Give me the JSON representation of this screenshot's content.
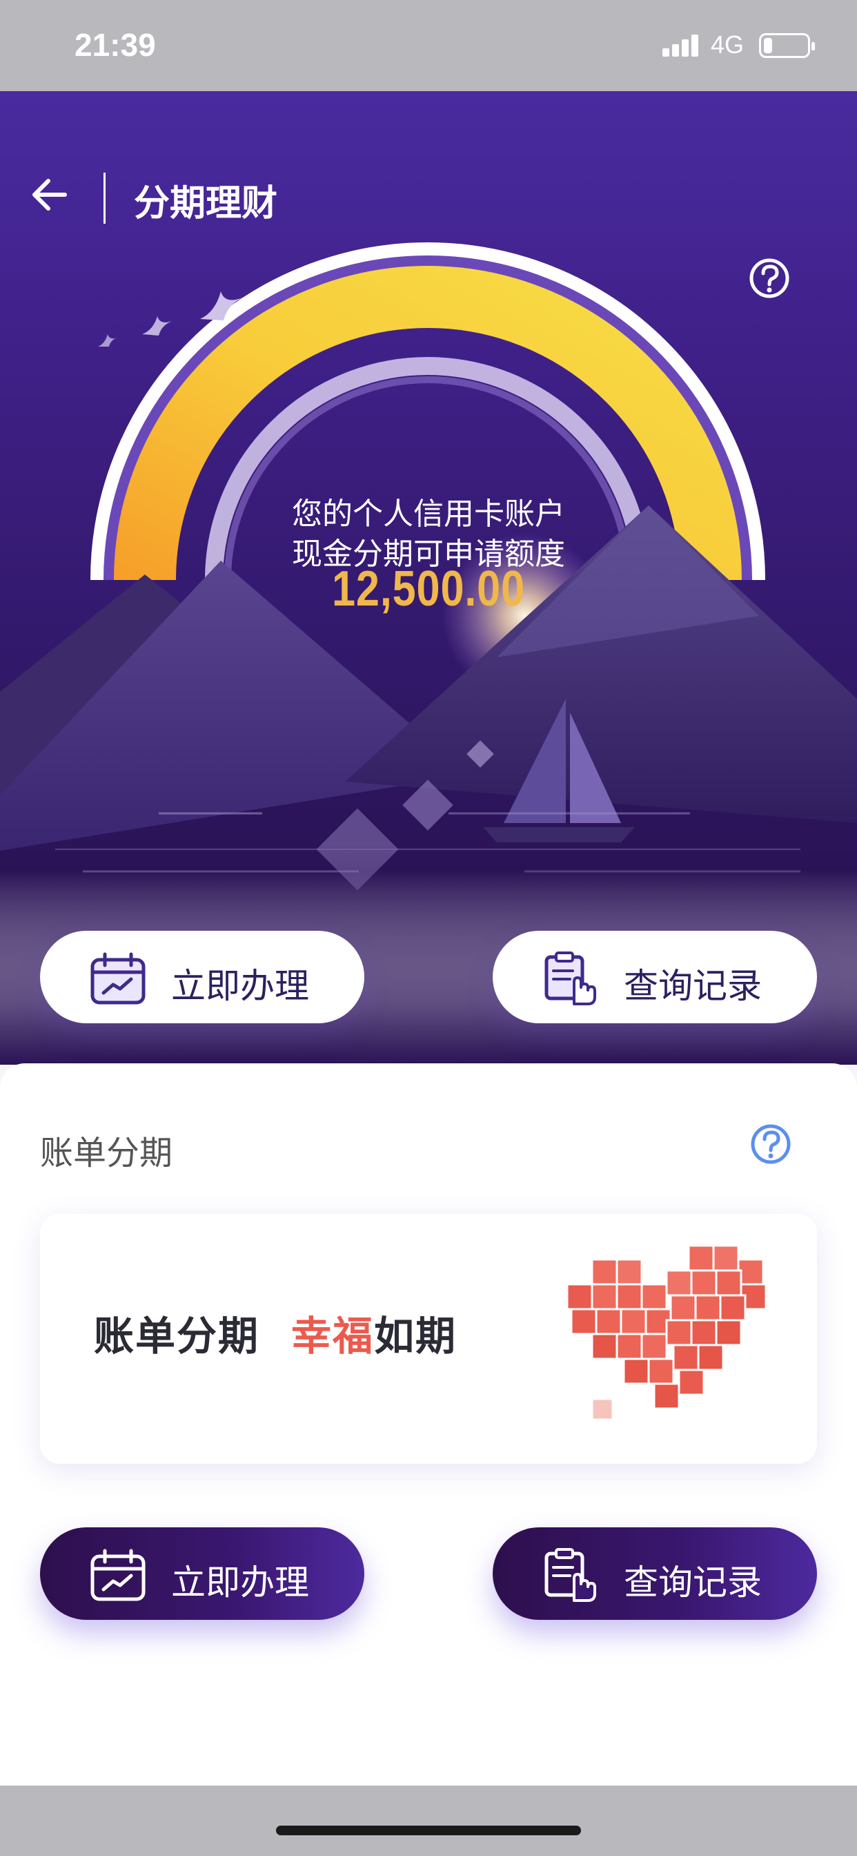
{
  "status_bar": {
    "time": "21:39",
    "network": "4G",
    "battery_icon": "battery-low-icon",
    "signal_icon": "signal-bars-icon"
  },
  "header": {
    "title": "分期理财",
    "back_icon": "arrow-left-icon",
    "help_icon": "question-circle-icon"
  },
  "hero": {
    "line1": "您的个人信用卡账户",
    "line2": "现金分期可申请额度",
    "amount": "12,500.00",
    "accent_color": "#f0b74a"
  },
  "cash_actions": {
    "apply": {
      "label": "立即办理",
      "icon": "calendar-chart-icon"
    },
    "records": {
      "label": "查询记录",
      "icon": "document-hand-icon"
    }
  },
  "bill_section": {
    "title": "账单分期",
    "help_icon": "question-circle-icon",
    "banner": {
      "part1": "账单分期",
      "part2_red": "幸福",
      "part3": "如期",
      "image_icon": "pixel-heart-icon"
    },
    "apply": {
      "label": "立即办理",
      "icon": "calendar-chart-icon"
    },
    "records": {
      "label": "查询记录",
      "icon": "document-hand-icon"
    }
  },
  "colors": {
    "brand_purple": "#4a2ba0",
    "dark_purple": "#2e0f4d",
    "banner_red": "#ec5a4e",
    "link_blue": "#5b8ef0"
  }
}
